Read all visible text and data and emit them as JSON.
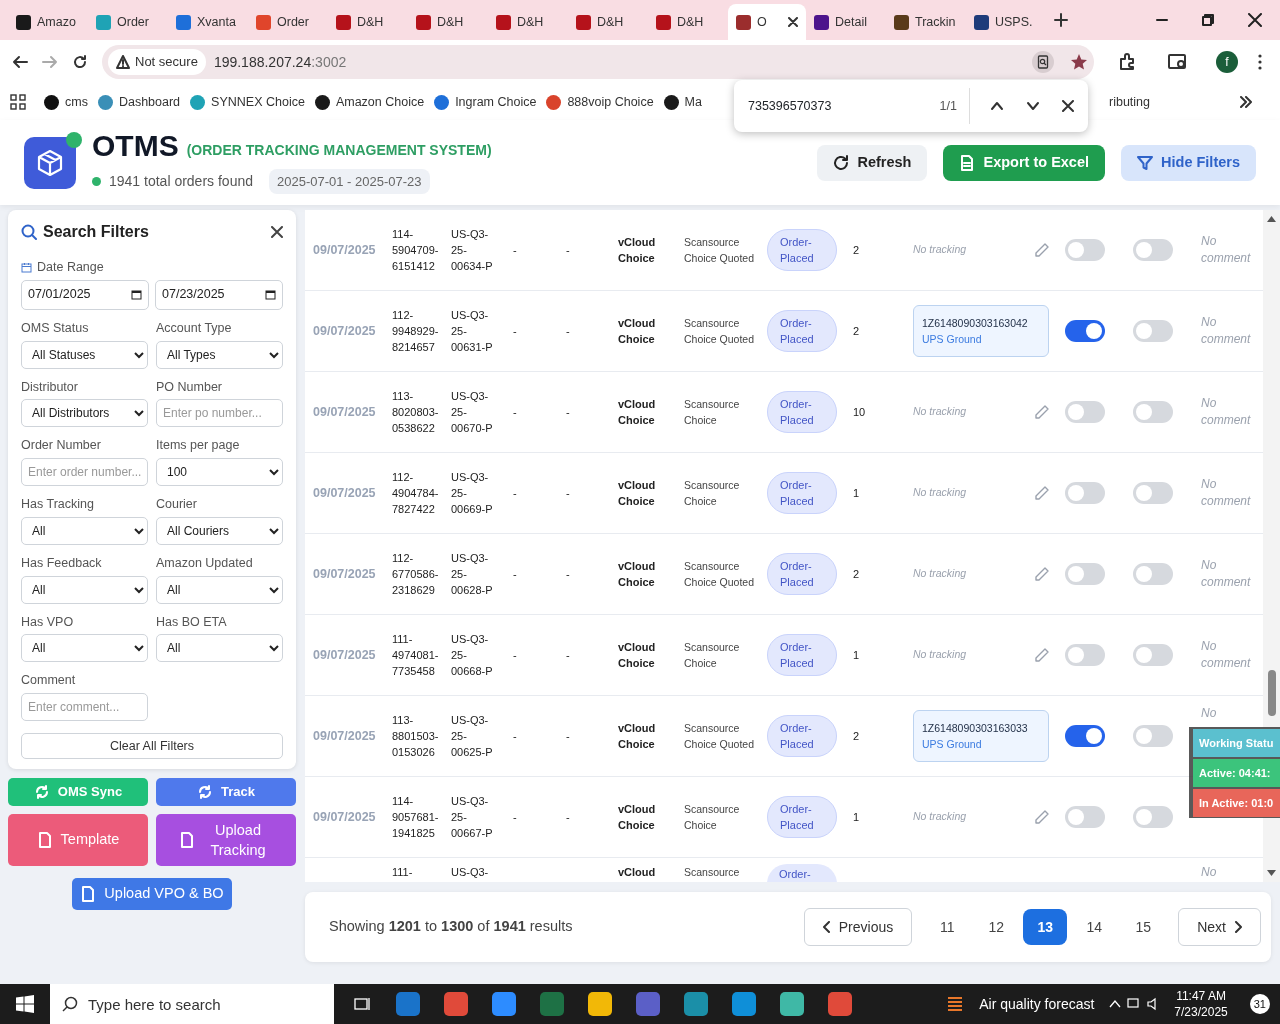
{
  "browser": {
    "tabs": [
      {
        "title": "Amazo",
        "color": "#1a1a1a",
        "selected": false
      },
      {
        "title": "Order",
        "color": "#1fa3b5",
        "selected": false
      },
      {
        "title": "Xvanta",
        "color": "#1e6fd9",
        "selected": false
      },
      {
        "title": "Order",
        "color": "#e0452b",
        "selected": false
      },
      {
        "title": "D&H",
        "color": "#b5121b",
        "selected": false
      },
      {
        "title": "D&H",
        "color": "#b5121b",
        "selected": false
      },
      {
        "title": "D&H",
        "color": "#b5121b",
        "selected": false
      },
      {
        "title": "D&H",
        "color": "#b5121b",
        "selected": false
      },
      {
        "title": "D&H",
        "color": "#b5121b",
        "selected": false
      },
      {
        "title": "O",
        "color": "#9b2d2d",
        "selected": true
      },
      {
        "title": "Detail",
        "color": "#4d148c",
        "selected": false
      },
      {
        "title": "Trackin",
        "color": "#5a3a1a",
        "selected": false
      },
      {
        "title": "USPS.",
        "color": "#1f3b7a",
        "selected": false
      }
    ],
    "address": {
      "security": "Not secure",
      "host": "199.188.207.24",
      "port": ":3002"
    },
    "profile": "f",
    "bookmarks": [
      {
        "label": "cms",
        "color": "#111111"
      },
      {
        "label": "Dashboard",
        "color": "#3a8fb7"
      },
      {
        "label": "SYNNEX Choice",
        "color": "#1fa3b5"
      },
      {
        "label": "Amazon Choice",
        "color": "#1a1a1a"
      },
      {
        "label": "Ingram Choice",
        "color": "#1e6fd9"
      },
      {
        "label": "888voip Choice",
        "color": "#d9432b"
      },
      {
        "label": "Ma",
        "color": "#1a1a1a"
      }
    ],
    "bookmark_cut": "ributing",
    "find_bar": {
      "query": "735396570373",
      "count": "1/1"
    }
  },
  "header": {
    "title": "OTMS",
    "subtitle": "(ORDER TRACKING MANAGEMENT SYSTEM)",
    "total": "1941 total orders found",
    "date_range": "2025-07-01 - 2025-07-23",
    "buttons": [
      {
        "label": "Refresh",
        "kind": "refresh"
      },
      {
        "label": "Export to Excel",
        "kind": "export"
      },
      {
        "label": "Hide Filters",
        "kind": "filter"
      }
    ]
  },
  "filters": {
    "title": "Search Filters",
    "date_label": "Date Range",
    "date_from": "07/01/2025",
    "date_to": "07/23/2025",
    "fields": [
      {
        "label": "OMS Status",
        "kind": "select",
        "value": "All Statuses"
      },
      {
        "label": "Account Type",
        "kind": "select",
        "value": "All Types"
      },
      {
        "label": "Distributor",
        "kind": "select",
        "value": "All Distributors"
      },
      {
        "label": "PO Number",
        "kind": "input",
        "placeholder": "Enter po number..."
      },
      {
        "label": "Order Number",
        "kind": "input",
        "placeholder": "Enter order number..."
      },
      {
        "label": "Items per page",
        "kind": "select",
        "value": "100"
      },
      {
        "label": "Has Tracking",
        "kind": "select",
        "value": "All"
      },
      {
        "label": "Courier",
        "kind": "select",
        "value": "All Couriers"
      },
      {
        "label": "Has Feedback",
        "kind": "select",
        "value": "All"
      },
      {
        "label": "Amazon Updated",
        "kind": "select",
        "value": "All"
      },
      {
        "label": "Has VPO",
        "kind": "select",
        "value": "All"
      },
      {
        "label": "Has BO ETA",
        "kind": "select",
        "value": "All"
      },
      {
        "label": "Comment",
        "kind": "input",
        "placeholder": "Enter comment..."
      }
    ],
    "clear": "Clear All Filters"
  },
  "actions": [
    {
      "label": "OMS Sync",
      "kind": "sync"
    },
    {
      "label": "Track",
      "kind": "track"
    },
    {
      "label": "Template",
      "kind": "template"
    },
    {
      "label": "Upload Tracking",
      "kind": "upload"
    },
    {
      "label": "Upload VPO & BO",
      "kind": "vpo"
    }
  ],
  "rows": [
    {
      "date": "09/07/2025",
      "order": "114-5904709-6151412",
      "po": "US-Q3-25-00634-P",
      "column_4": "-",
      "column_5": "-",
      "distributor": "vCloud Choice",
      "account": "Scansource Choice Quoted",
      "status": "Order-Placed",
      "qty": "2",
      "tracking": "No tracking",
      "toggle_1": false,
      "toggle_2": false,
      "comment": "No comment"
    },
    {
      "date": "09/07/2025",
      "order": "112-9948929-8214657",
      "po": "US-Q3-25-00631-P",
      "column_4": "-",
      "column_5": "-",
      "distributor": "vCloud Choice",
      "account": "Scansource Choice Quoted",
      "status": "Order-Placed",
      "qty": "2",
      "tracking_number": "1Z6148090303163042",
      "courier": "UPS Ground",
      "toggle_1": true,
      "toggle_2": false,
      "comment": "No comment"
    },
    {
      "date": "09/07/2025",
      "order": "113-8020803-0538622",
      "po": "US-Q3-25-00670-P",
      "column_4": "-",
      "column_5": "-",
      "distributor": "vCloud Choice",
      "account": "Scansource Choice",
      "status": "Order-Placed",
      "qty": "10",
      "tracking": "No tracking",
      "toggle_1": false,
      "toggle_2": false,
      "comment": "No comment"
    },
    {
      "date": "09/07/2025",
      "order": "112-4904784-7827422",
      "po": "US-Q3-25-00669-P",
      "column_4": "-",
      "column_5": "-",
      "distributor": "vCloud Choice",
      "account": "Scansource Choice",
      "status": "Order-Placed",
      "qty": "1",
      "tracking": "No tracking",
      "toggle_1": false,
      "toggle_2": false,
      "comment": "No comment"
    },
    {
      "date": "09/07/2025",
      "order": "112-6770586-2318629",
      "po": "US-Q3-25-00628-P",
      "column_4": "-",
      "column_5": "-",
      "distributor": "vCloud Choice",
      "account": "Scansource Choice Quoted",
      "status": "Order-Placed",
      "qty": "2",
      "tracking": "No tracking",
      "toggle_1": false,
      "toggle_2": false,
      "comment": "No comment"
    },
    {
      "date": "09/07/2025",
      "order": "111-4974081-7735458",
      "po": "US-Q3-25-00668-P",
      "column_4": "-",
      "column_5": "-",
      "distributor": "vCloud Choice",
      "account": "Scansource Choice",
      "status": "Order-Placed",
      "qty": "1",
      "tracking": "No tracking",
      "toggle_1": false,
      "toggle_2": false,
      "comment": "No comment"
    },
    {
      "date": "09/07/2025",
      "order": "113-8801503-0153026",
      "po": "US-Q3-25-00625-P",
      "column_4": "-",
      "column_5": "-",
      "distributor": "vCloud Choice",
      "account": "Scansource Choice Quoted",
      "status": "Order-Placed",
      "qty": "2",
      "tracking_number": "1Z6148090303163033",
      "courier": "UPS Ground",
      "toggle_1": true,
      "toggle_2": false,
      "comment": "No"
    },
    {
      "date": "09/07/2025",
      "order": "114-9057681-1941825",
      "po": "US-Q3-25-00667-P",
      "column_4": "-",
      "column_5": "-",
      "distributor": "vCloud Choice",
      "account": "Scansource Choice",
      "status": "Order-Placed",
      "qty": "1",
      "tracking": "No tracking",
      "toggle_1": false,
      "toggle_2": false
    }
  ],
  "partial_row": {
    "order": "111-",
    "po": "US-Q3-",
    "distributor": "vCloud",
    "account": "Scansource",
    "status": "Order-",
    "comment": "No"
  },
  "work_status": [
    {
      "label": "Working Statu",
      "color": "#5bc0cf"
    },
    {
      "label": "Active: 04:41:",
      "color": "#3cc47c"
    },
    {
      "label": "In Active: 01:0",
      "color": "#e8665a"
    }
  ],
  "pagination": {
    "summary": "Showing **1201** to **1300** of **1941** results",
    "previous": "Previous",
    "next": "Next",
    "pages": [
      {
        "label": "11",
        "selected": false
      },
      {
        "label": "12",
        "selected": false
      },
      {
        "label": "13",
        "selected": true
      },
      {
        "label": "14",
        "selected": false
      },
      {
        "label": "15",
        "selected": false
      }
    ]
  },
  "taskbar": {
    "search_placeholder": "Type here to search",
    "apps": [
      {
        "color": "#1a73c9"
      },
      {
        "color": "#e04a3a"
      },
      {
        "color": "#2d8cff"
      },
      {
        "color": "#1e7145"
      },
      {
        "color": "#f2b807"
      },
      {
        "color": "#5b5fc7"
      },
      {
        "color": "#1b8fa8"
      },
      {
        "color": "#0f8fd8"
      },
      {
        "color": "#3fb8a6"
      },
      {
        "color": "#e04a3a"
      }
    ],
    "weather": "Air quality forecast",
    "time": "11:47 AM",
    "date": "7/23/2025",
    "notifications": "31"
  }
}
